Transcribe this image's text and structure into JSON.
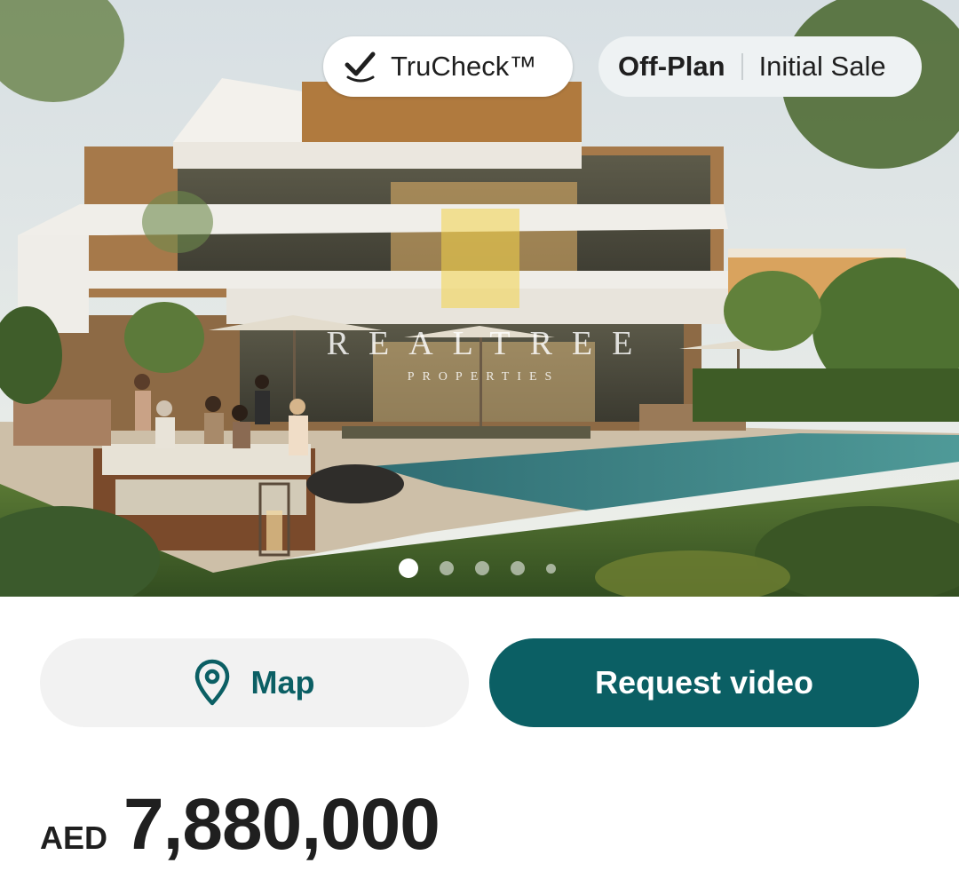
{
  "listing": {
    "badge_trucheck": "TruCheck™",
    "status_primary": "Off-Plan",
    "status_secondary": "Initial Sale",
    "watermark_title": "REALTREE",
    "watermark_subtitle": "PROPERTIES",
    "gallery": {
      "total_images": 5,
      "active_index": 0
    }
  },
  "actions": {
    "map_label": "Map",
    "request_video_label": "Request video"
  },
  "price": {
    "currency": "AED",
    "amount": "7,880,000"
  },
  "icons": {
    "trucheck": "check-badge-icon",
    "map": "location-pin-icon"
  },
  "colors": {
    "brand_teal": "#0b5f64",
    "map_button_bg": "#f2f2f2",
    "status_pill_bg": "#eef2f3"
  }
}
